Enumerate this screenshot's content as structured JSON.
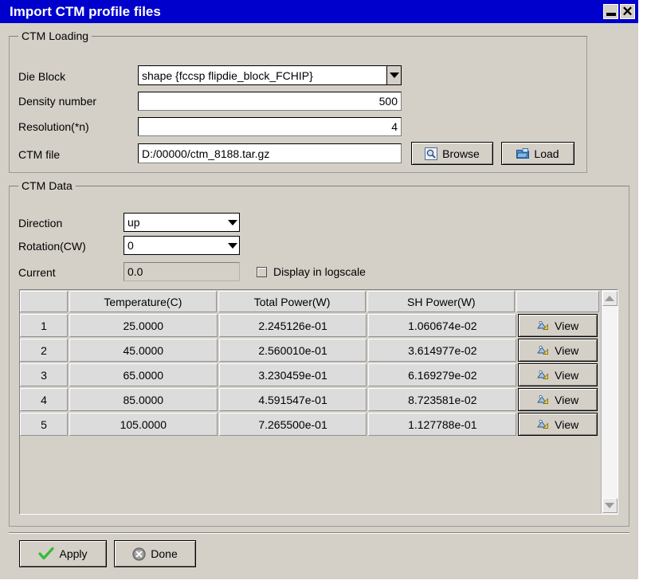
{
  "window": {
    "title": "Import CTM profile files",
    "minimize_label": "_",
    "close_label": "✕"
  },
  "ctm_loading": {
    "legend": "CTM Loading",
    "die_block": {
      "label": "Die Block",
      "value": "shape {fccsp flipdie_block_FCHIP}"
    },
    "density_number": {
      "label": "Density number",
      "value": "500"
    },
    "resolution": {
      "label": "Resolution(*n)",
      "value": "4"
    },
    "ctm_file": {
      "label": "CTM file",
      "value": "D:/00000/ctm_8188.tar.gz"
    },
    "browse_button": "Browse",
    "load_button": "Load"
  },
  "ctm_data": {
    "legend": "CTM Data",
    "direction": {
      "label": "Direction",
      "value": "up"
    },
    "rotation": {
      "label": "Rotation(CW)",
      "value": "0"
    },
    "current": {
      "label": "Current",
      "value": "0.0"
    },
    "logscale": {
      "label": "Display in logscale",
      "checked": false
    },
    "table": {
      "columns": [
        "",
        "Temperature(C)",
        "Total Power(W)",
        "SH Power(W)",
        ""
      ],
      "rows": [
        {
          "index": "1",
          "temperature": "25.0000",
          "total_power": "2.245126e-01",
          "sh_power": "1.060674e-02",
          "action": "View"
        },
        {
          "index": "2",
          "temperature": "45.0000",
          "total_power": "2.560010e-01",
          "sh_power": "3.614977e-02",
          "action": "View"
        },
        {
          "index": "3",
          "temperature": "65.0000",
          "total_power": "3.230459e-01",
          "sh_power": "6.169279e-02",
          "action": "View"
        },
        {
          "index": "4",
          "temperature": "85.0000",
          "total_power": "4.591547e-01",
          "sh_power": "8.723581e-02",
          "action": "View"
        },
        {
          "index": "5",
          "temperature": "105.0000",
          "total_power": "7.265500e-01",
          "sh_power": "1.127788e-01",
          "action": "View"
        }
      ]
    }
  },
  "footer": {
    "apply_button": "Apply",
    "done_button": "Done"
  },
  "colors": {
    "titlebar": "#0000cc",
    "dialog_bg": "#d4d0c8",
    "field_bg": "#ffffff",
    "apply_check": "#33bb33",
    "done_circle": "#808080"
  }
}
